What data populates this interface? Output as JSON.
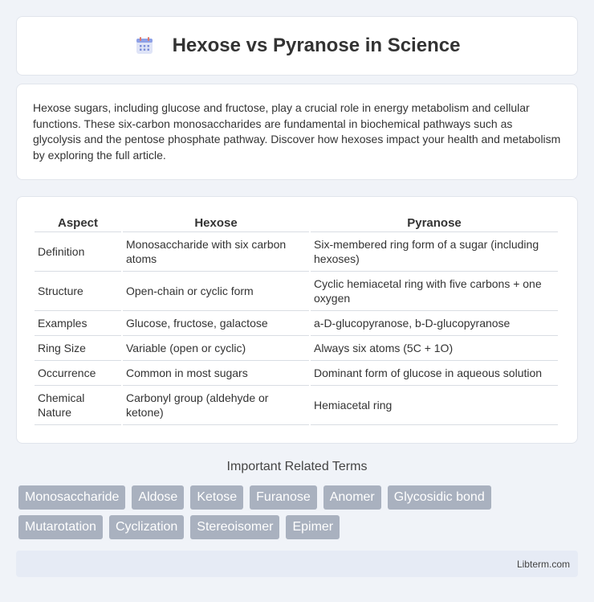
{
  "header": {
    "title": "Hexose vs Pyranose in Science",
    "icon": "calendar-grid-icon"
  },
  "intro": {
    "text": "Hexose sugars, including glucose and fructose, play a crucial role in energy metabolism and cellular functions. These six-carbon monosaccharides are fundamental in biochemical pathways such as glycolysis and the pentose phosphate pathway. Discover how hexoses impact your health and metabolism by exploring the full article."
  },
  "table": {
    "headers": [
      "Aspect",
      "Hexose",
      "Pyranose"
    ],
    "rows": [
      [
        "Definition",
        "Monosaccharide with six carbon atoms",
        "Six-membered ring form of a sugar (including hexoses)"
      ],
      [
        "Structure",
        "Open-chain or cyclic form",
        "Cyclic hemiacetal ring with five carbons + one oxygen"
      ],
      [
        "Examples",
        "Glucose, fructose, galactose",
        "a-D-glucopyranose, b-D-glucopyranose"
      ],
      [
        "Ring Size",
        "Variable (open or cyclic)",
        "Always six atoms (5C + 1O)"
      ],
      [
        "Occurrence",
        "Common in most sugars",
        "Dominant form of glucose in aqueous solution"
      ],
      [
        "Chemical Nature",
        "Carbonyl group (aldehyde or ketone)",
        "Hemiacetal ring"
      ]
    ]
  },
  "related": {
    "title": "Important Related Terms",
    "tags": [
      "Monosaccharide",
      "Aldose",
      "Ketose",
      "Furanose",
      "Anomer",
      "Glycosidic bond",
      "Mutarotation",
      "Cyclization",
      "Stereoisomer",
      "Epimer"
    ]
  },
  "footer": {
    "text": "Libterm.com"
  },
  "colors": {
    "tag_bg": "#a9b1bf",
    "page_bg": "#f0f3f8",
    "footer_bg": "#e6ebf5"
  }
}
